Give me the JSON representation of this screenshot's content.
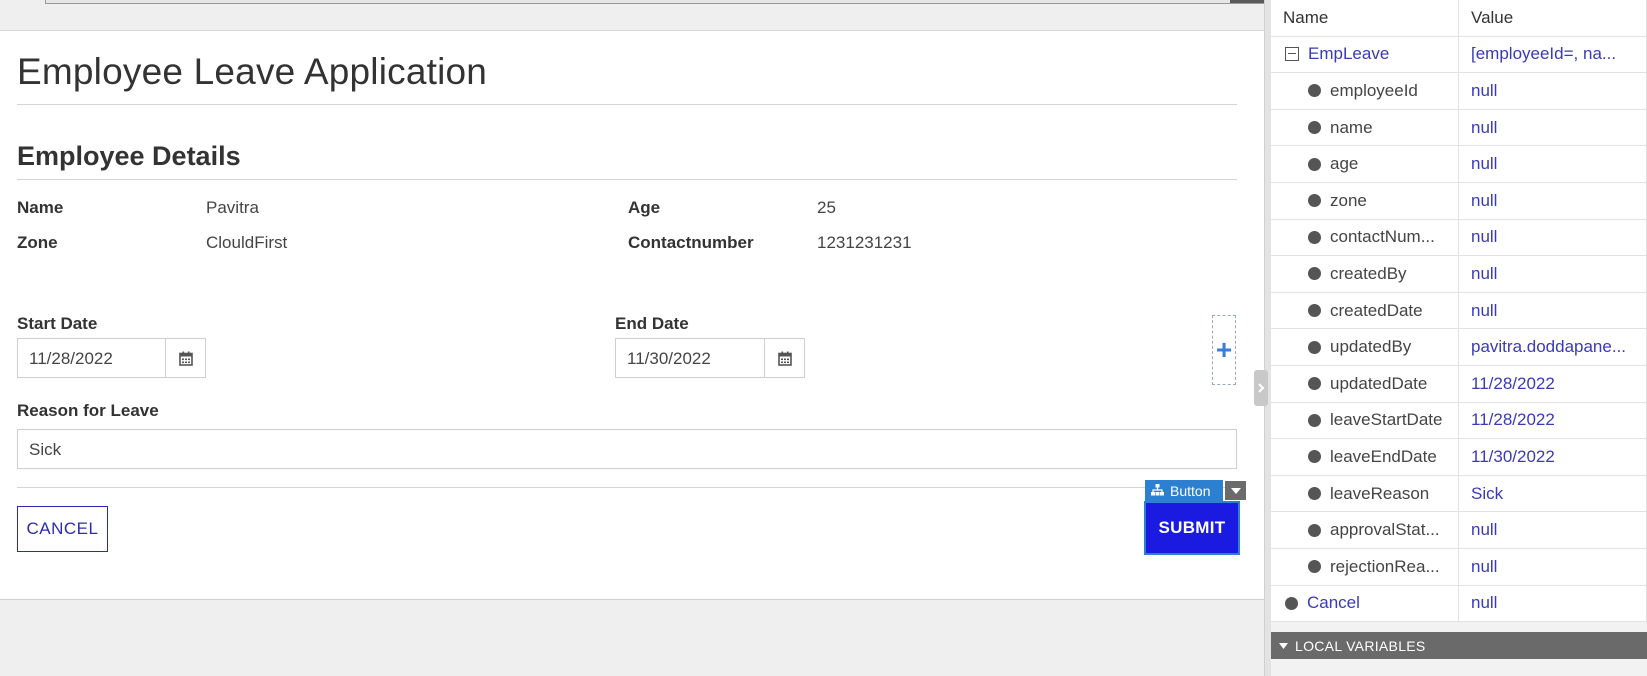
{
  "form": {
    "title": "Employee Leave Application",
    "section_title": "Employee Details",
    "fields": {
      "name_label": "Name",
      "name_value": "Pavitra",
      "age_label": "Age",
      "age_value": "25",
      "zone_label": "Zone",
      "zone_value": "ClouldFirst",
      "contact_label": "Contactnumber",
      "contact_value": "1231231231"
    },
    "start_date": {
      "label": "Start Date",
      "value": "11/28/2022",
      "icon": "calendar-icon"
    },
    "end_date": {
      "label": "End Date",
      "value": "11/30/2022",
      "icon": "calendar-icon"
    },
    "reason": {
      "label": "Reason for Leave",
      "value": "Sick"
    },
    "add_icon": "+",
    "cancel_label": "CANCEL",
    "submit_label": "SUBMIT",
    "selection_tag": {
      "label": "Button",
      "icon": "widget-tree-icon"
    }
  },
  "panel": {
    "headers": {
      "name": "Name",
      "value": "Value"
    },
    "root": {
      "name": "EmpLeave",
      "value": "[employeeId=, na..."
    },
    "rows": [
      {
        "name": "employeeId",
        "value": "null"
      },
      {
        "name": "name",
        "value": "null"
      },
      {
        "name": "age",
        "value": "null"
      },
      {
        "name": "zone",
        "value": "null"
      },
      {
        "name": "contactNum...",
        "value": "null"
      },
      {
        "name": "createdBy",
        "value": "null"
      },
      {
        "name": "createdDate",
        "value": "null"
      },
      {
        "name": "updatedBy",
        "value": "pavitra.doddapane..."
      },
      {
        "name": "updatedDate",
        "value": "11/28/2022"
      },
      {
        "name": "leaveStartDate",
        "value": "11/28/2022"
      },
      {
        "name": "leaveEndDate",
        "value": "11/30/2022"
      },
      {
        "name": "leaveReason",
        "value": "Sick"
      },
      {
        "name": "approvalStat...",
        "value": "null"
      },
      {
        "name": "rejectionRea...",
        "value": "null"
      }
    ],
    "cancel_row": {
      "name": "Cancel",
      "value": "null"
    },
    "local_variables_label": "LOCAL VARIABLES"
  },
  "colors": {
    "accent": "#1a1ae0",
    "link": "#3a3ab8",
    "selection": "#2d7fd0"
  }
}
